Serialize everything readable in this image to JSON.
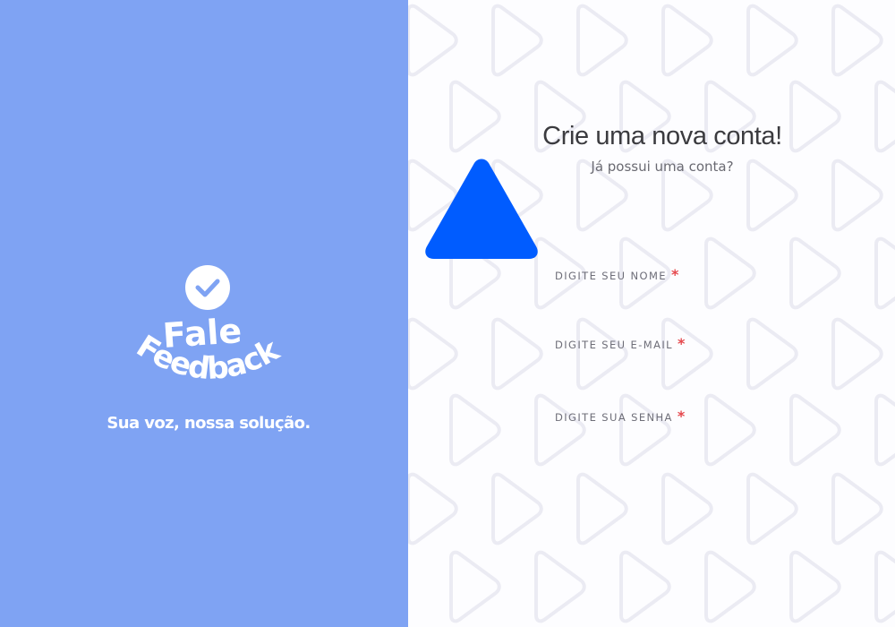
{
  "brand": {
    "logo_line1": "Fale",
    "logo_line2": "Feedback",
    "tagline": "Sua voz, nossa solução.",
    "color": "#7fa3f3"
  },
  "form": {
    "title": "Crie uma nova conta!",
    "login_link": "Já possui uma conta?",
    "fields": [
      {
        "label": "DIGITE SEU NOME",
        "required": "*",
        "value": ""
      },
      {
        "label": "DIGITE SEU E-MAIL",
        "required": "*",
        "value": ""
      },
      {
        "label": "DIGITE SUA SENHA",
        "required": "*",
        "value": ""
      }
    ]
  },
  "colors": {
    "accent": "#005cff",
    "required": "#e5484d",
    "left_panel_bg": "#7fa3f3",
    "right_panel_bg": "#fdfdff"
  },
  "icons": {
    "logo_badge": "check-circle-icon",
    "decoration": "triangle-icon",
    "background_pattern": "play-triangle-icon"
  }
}
